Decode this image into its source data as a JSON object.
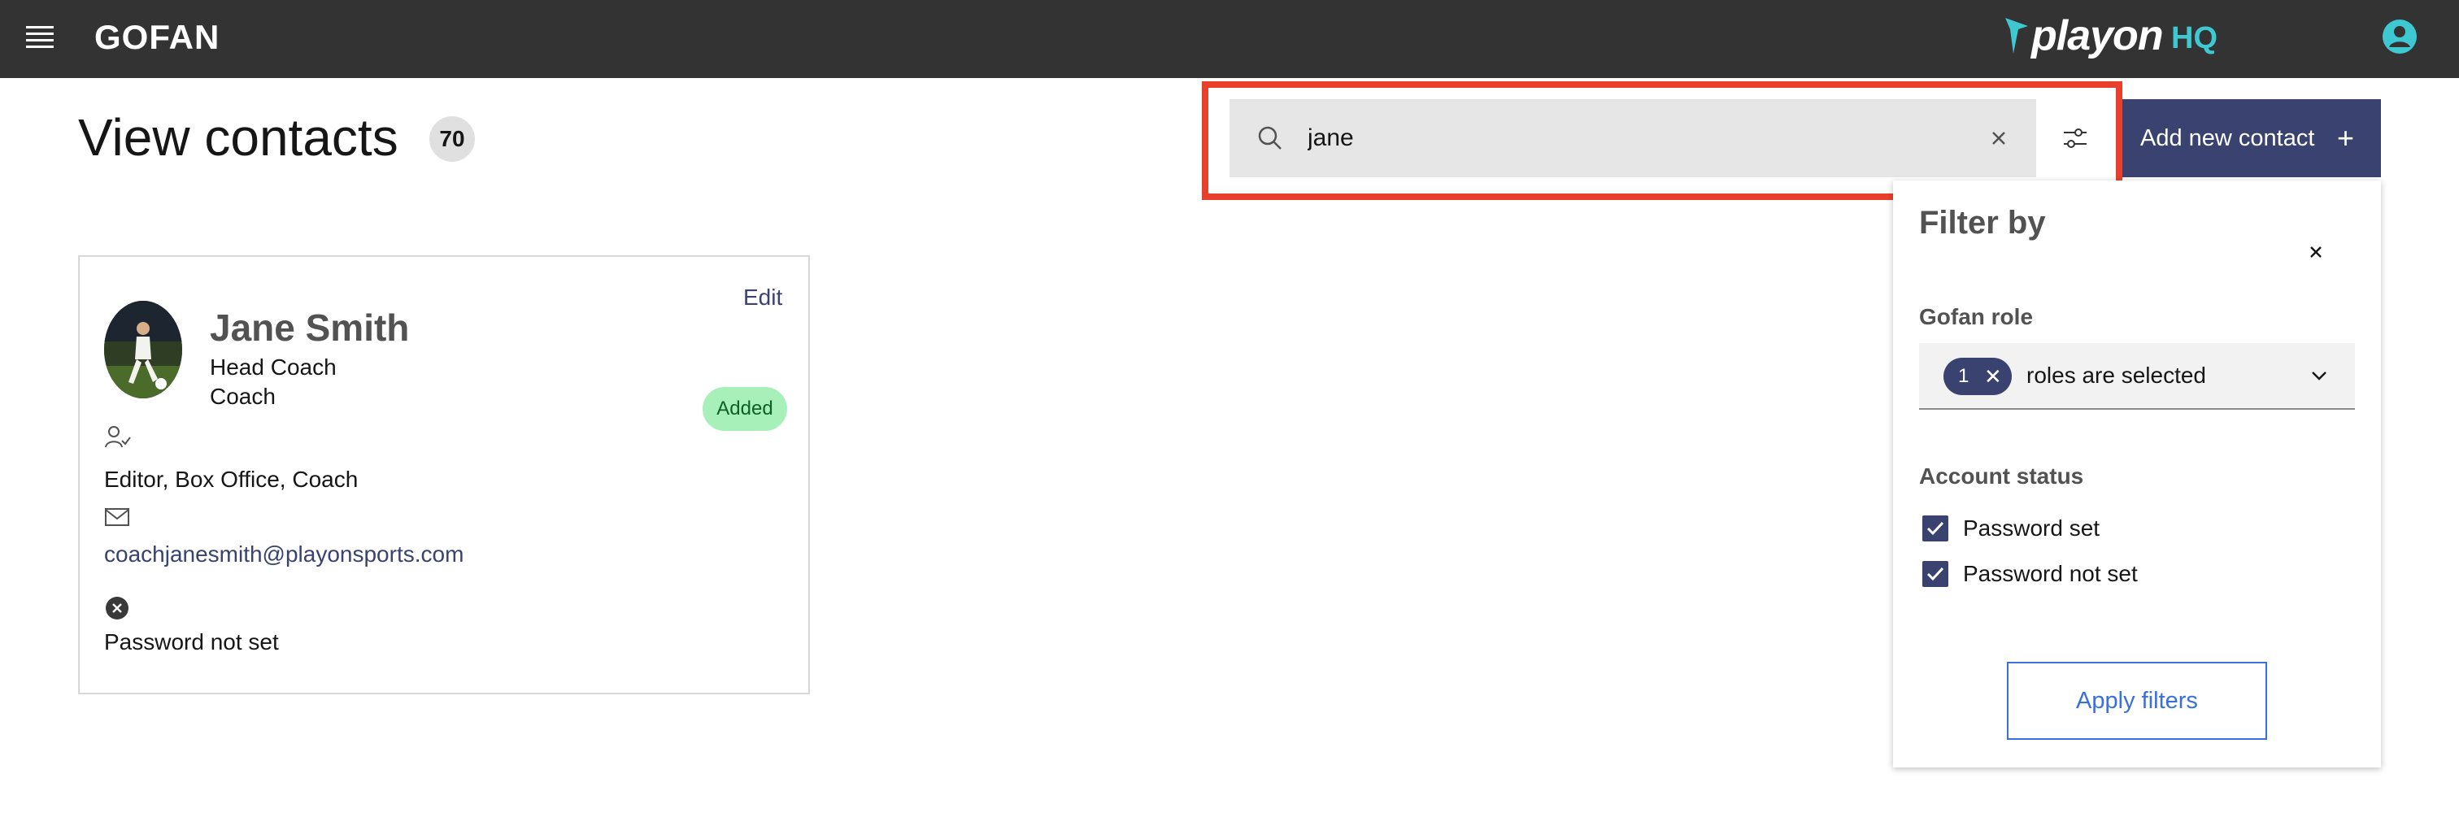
{
  "header": {
    "brand": "GOFAN",
    "logo_word": "playon",
    "logo_hq": "HQ",
    "menu_icon": "hamburger-menu-icon",
    "user_icon": "user-account-icon"
  },
  "page": {
    "title": "View contacts",
    "count": "70"
  },
  "search": {
    "value": "jane",
    "icon": "search-icon",
    "clear_icon": "close-icon",
    "filter_icon": "sliders-icon"
  },
  "toolbar": {
    "add_label": "Add new contact",
    "add_icon": "+"
  },
  "contact": {
    "name": "Jane Smith",
    "title": "Head Coach",
    "role": "Coach",
    "edit_label": "Edit",
    "status_badge": "Added",
    "permissions": "Editor, Box Office, Coach",
    "email": "coachjanesmith@playonsports.com",
    "password_status": "Password not set"
  },
  "filter": {
    "title": "Filter by",
    "role_label": "Gofan role",
    "role_tag_count": "1",
    "role_select_text": "roles are selected",
    "account_status_label": "Account status",
    "options": [
      {
        "label": "Password set",
        "checked": true
      },
      {
        "label": "Password not set",
        "checked": true
      }
    ],
    "apply_label": "Apply filters"
  },
  "colors": {
    "header_bg": "#333333",
    "accent": "#3a4270",
    "highlight": "#e8402c",
    "badge_green": "#a7f0ba",
    "logo_hq": "#3ec8d2",
    "apply_blue": "#3a6fdc"
  }
}
